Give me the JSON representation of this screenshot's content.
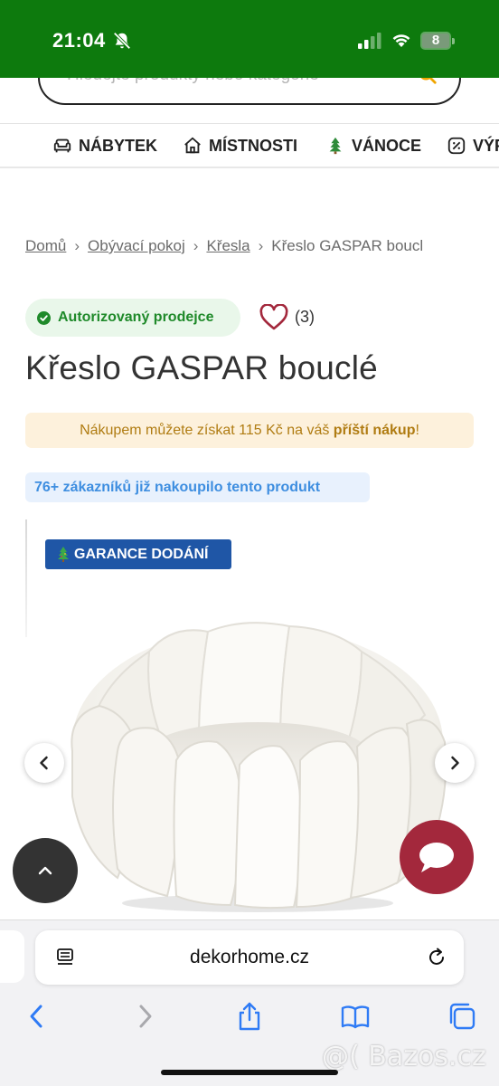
{
  "status_bar": {
    "time": "21:04",
    "battery": "8"
  },
  "search": {
    "placeholder": "Hledejte produkty nebo kategorie"
  },
  "categories": [
    {
      "label": "NÁBYTEK",
      "icon": "sofa-icon"
    },
    {
      "label": "MÍSTNOSTI",
      "icon": "house-icon"
    },
    {
      "label": "VÁNOCE",
      "icon": "christmas-tree-icon"
    },
    {
      "label": "VÝP",
      "icon": "percent-icon"
    }
  ],
  "breadcrumb": [
    {
      "label": "Domů"
    },
    {
      "label": "Obývací pokoj"
    },
    {
      "label": "Křesla"
    },
    {
      "label": "Křeslo GASPAR boucl"
    }
  ],
  "product": {
    "seller_badge": "Autorizovaný prodejce",
    "favorites_count": "(3)",
    "title": "Křeslo GASPAR bouclé",
    "loyalty_prefix": "Nákupem můžete získat 115 Kč na váš ",
    "loyalty_link": "příští nákup",
    "loyalty_suffix": "!",
    "customers_badge": "76+ zákazníků již nakoupilo tento produkt",
    "delivery_badge": "GARANCE DODÁNÍ"
  },
  "browser": {
    "url": "dekorhome.cz"
  },
  "watermark": "@( Bazos.cz",
  "colors": {
    "status_bar": "#0d7a0d",
    "seller_green": "#1f8a2a",
    "heart": "#a3283c",
    "delivery_blue": "#1f56a6",
    "customers_blue": "#3e8ee0",
    "loyalty_gold": "#b07c12",
    "chat_button": "#a3283c",
    "safari_blue": "#2f7bf5"
  }
}
